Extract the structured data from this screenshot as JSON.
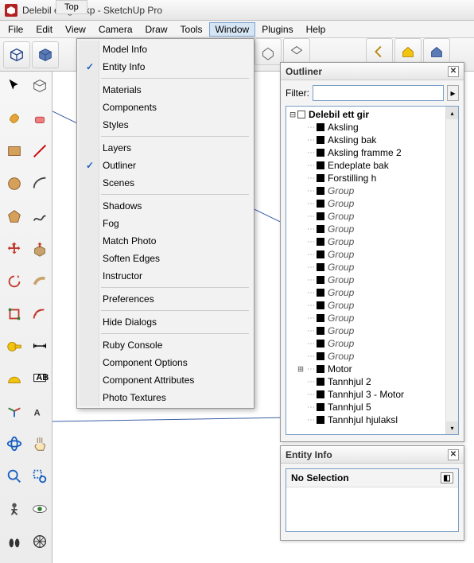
{
  "title": "Delebil ett gir.skp - SketchUp Pro",
  "menubar": [
    "File",
    "Edit",
    "View",
    "Camera",
    "Draw",
    "Tools",
    "Window",
    "Plugins",
    "Help"
  ],
  "active_menu_index": 6,
  "tab": "Top",
  "dropdown": [
    {
      "label": "Model Info",
      "checked": false
    },
    {
      "label": "Entity Info",
      "checked": true
    },
    {
      "sep": true
    },
    {
      "label": "Materials",
      "checked": false
    },
    {
      "label": "Components",
      "checked": false
    },
    {
      "label": "Styles",
      "checked": false
    },
    {
      "sep": true
    },
    {
      "label": "Layers",
      "checked": false
    },
    {
      "label": "Outliner",
      "checked": true
    },
    {
      "label": "Scenes",
      "checked": false
    },
    {
      "sep": true
    },
    {
      "label": "Shadows",
      "checked": false
    },
    {
      "label": "Fog",
      "checked": false
    },
    {
      "label": "Match Photo",
      "checked": false
    },
    {
      "label": "Soften Edges",
      "checked": false
    },
    {
      "label": "Instructor",
      "checked": false
    },
    {
      "sep": true
    },
    {
      "label": "Preferences",
      "checked": false
    },
    {
      "sep": true
    },
    {
      "label": "Hide Dialogs",
      "checked": false
    },
    {
      "sep": true
    },
    {
      "label": "Ruby Console",
      "checked": false
    },
    {
      "label": "Component Options",
      "checked": false
    },
    {
      "label": "Component Attributes",
      "checked": false
    },
    {
      "label": "Photo Textures",
      "checked": false
    }
  ],
  "outliner": {
    "title": "Outliner",
    "filter_label": "Filter:",
    "root": "Delebil ett gir",
    "items": [
      {
        "label": "Aksling",
        "italic": false
      },
      {
        "label": "Aksling bak",
        "italic": false
      },
      {
        "label": "Aksling framme 2",
        "italic": false
      },
      {
        "label": "Endeplate bak",
        "italic": false
      },
      {
        "label": "Forstilling h",
        "italic": false
      },
      {
        "label": "Group",
        "italic": true
      },
      {
        "label": "Group",
        "italic": true
      },
      {
        "label": "Group",
        "italic": true
      },
      {
        "label": "Group",
        "italic": true
      },
      {
        "label": "Group",
        "italic": true
      },
      {
        "label": "Group",
        "italic": true
      },
      {
        "label": "Group",
        "italic": true
      },
      {
        "label": "Group",
        "italic": true
      },
      {
        "label": "Group",
        "italic": true
      },
      {
        "label": "Group",
        "italic": true
      },
      {
        "label": "Group",
        "italic": true
      },
      {
        "label": "Group",
        "italic": true
      },
      {
        "label": "Group",
        "italic": true
      },
      {
        "label": "Group",
        "italic": true
      },
      {
        "label": "Motor",
        "italic": false,
        "expand": true
      },
      {
        "label": "Tannhjul 2",
        "italic": false
      },
      {
        "label": "Tannhjul 3 - Motor",
        "italic": false
      },
      {
        "label": "Tannhjul 5",
        "italic": false
      },
      {
        "label": "Tannhjul hjulaksl",
        "italic": false
      }
    ]
  },
  "entity_info": {
    "title": "Entity Info",
    "status": "No Selection"
  }
}
